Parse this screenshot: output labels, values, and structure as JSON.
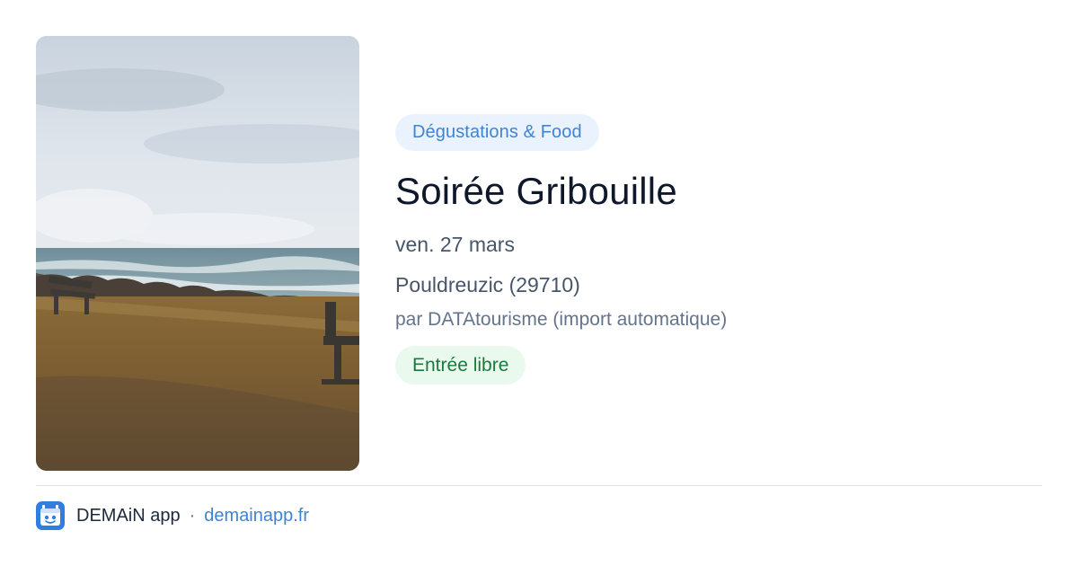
{
  "event": {
    "category": "Dégustations & Food",
    "title": "Soirée Gribouille",
    "date": "ven. 27 mars",
    "location": "Pouldreuzic (29710)",
    "organizer": "par DATAtourisme (import automatique)",
    "price": "Entrée libre"
  },
  "footer": {
    "app_name": "DEMAiN app",
    "separator": "·",
    "url": "demainapp.fr"
  },
  "icons": {
    "logo": "demain-app-logo-icon"
  },
  "colors": {
    "category_bg": "#eaf3fd",
    "category_text": "#3f83d3",
    "title_text": "#0f172a",
    "meta_text": "#475569",
    "organizer_text": "#64748b",
    "price_bg": "#eaf9ee",
    "price_text": "#1a7a3b",
    "link_text": "#3f83d3",
    "logo_bg": "#2f7fe0"
  }
}
